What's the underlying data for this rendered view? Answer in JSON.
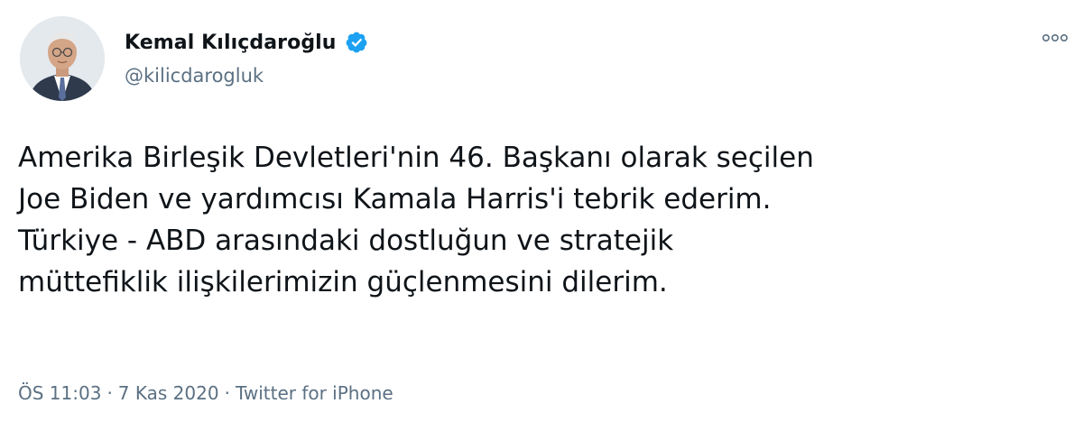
{
  "author": {
    "display_name": "Kemal Kılıçdaroğlu",
    "handle": "@kilicdarogluk",
    "verified": true,
    "avatar_icon": "profile-photo"
  },
  "tweet": {
    "lines": [
      "Amerika Birleşik Devletleri'nin 46. Başkanı olarak seçilen",
      "Joe Biden ve yardımcısı Kamala Harris'i tebrik ederim.",
      "Türkiye - ABD arasındaki dostluğun ve stratejik",
      "müttefiklik ilişkilerimizin güçlenmesini dilerim."
    ]
  },
  "meta": {
    "time": "ÖS 11:03",
    "separator": "·",
    "date": "7 Kas 2020",
    "source": "Twitter for iPhone"
  },
  "colors": {
    "text": "#0f1419",
    "secondary": "#5b7083",
    "verified": "#1da1f2"
  },
  "icons": {
    "verified": "verified-badge-icon",
    "more": "more-options-icon"
  }
}
